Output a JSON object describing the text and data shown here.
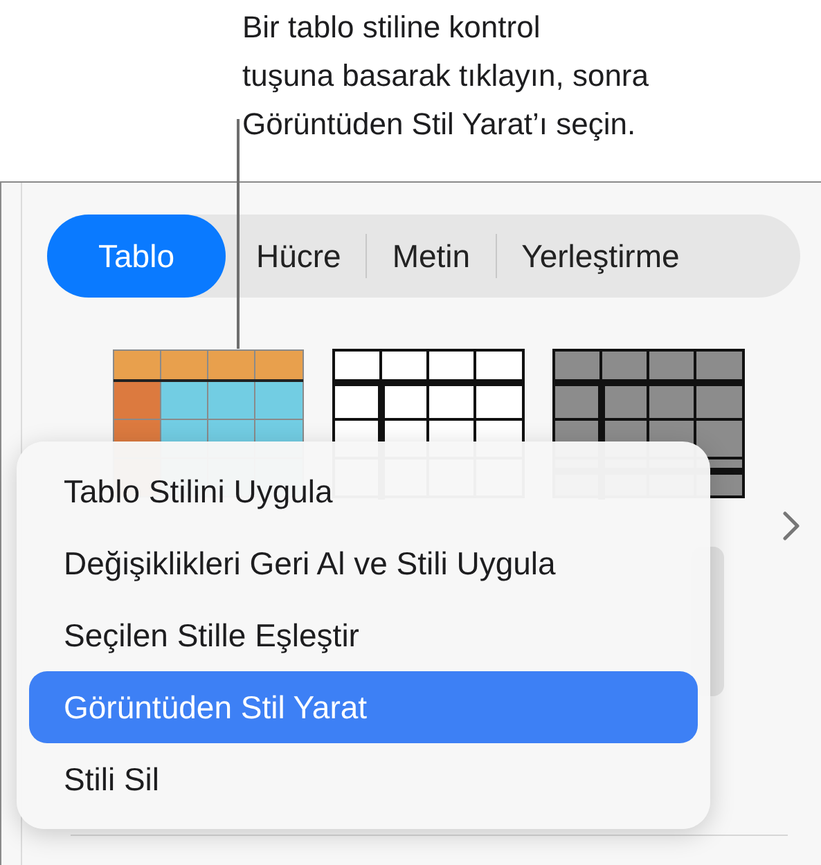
{
  "callout": {
    "lines": [
      "Bir tablo stiline kontrol",
      "tuşuna basarak tıklayın, sonra",
      "Görüntüden Stil Yarat’ı seçin."
    ]
  },
  "tabs": [
    {
      "label": "Tablo",
      "selected": true
    },
    {
      "label": "Hücre",
      "selected": false
    },
    {
      "label": "Metin",
      "selected": false
    },
    {
      "label": "Yerleştirme",
      "selected": false
    }
  ],
  "context_menu": {
    "items": [
      {
        "label": "Tablo Stilini Uygula",
        "selected": false
      },
      {
        "label": "Değişiklikleri Geri Al ve Stili Uygula",
        "selected": false
      },
      {
        "label": "Seçilen Stille Eşleştir",
        "selected": false
      },
      {
        "label": "Görüntüden Stil Yarat",
        "selected": true
      },
      {
        "label": "Stili Sil",
        "selected": false
      }
    ]
  }
}
